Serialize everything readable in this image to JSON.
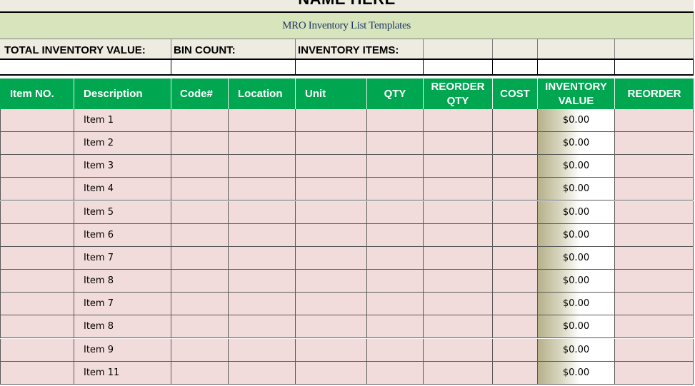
{
  "sheet": {
    "title": "NAME HERE",
    "subtitle": "MRO Inventory List Templates"
  },
  "summary": {
    "total_inventory_value_label": "TOTAL INVENTORY VALUE:",
    "bin_count_label": "BIN COUNT:",
    "inventory_items_label": "INVENTORY ITEMS:"
  },
  "table": {
    "headers": [
      "Item NO.",
      "Description",
      "Code#",
      "Location",
      "Unit",
      "QTY",
      "REORDER QTY",
      "COST",
      "INVENTORY VALUE",
      "REORDER"
    ],
    "rows": [
      {
        "item_no": "",
        "description": "Item 1",
        "code": "",
        "location": "",
        "unit": "",
        "qty": "",
        "reorder_qty": "",
        "cost": "",
        "inventory_value": "$0.00",
        "reorder": ""
      },
      {
        "item_no": "",
        "description": "Item 2",
        "code": "",
        "location": "",
        "unit": "",
        "qty": "",
        "reorder_qty": "",
        "cost": "",
        "inventory_value": "$0.00",
        "reorder": ""
      },
      {
        "item_no": "",
        "description": "Item 3",
        "code": "",
        "location": "",
        "unit": "",
        "qty": "",
        "reorder_qty": "",
        "cost": "",
        "inventory_value": "$0.00",
        "reorder": ""
      },
      {
        "item_no": "",
        "description": "Item 4",
        "code": "",
        "location": "",
        "unit": "",
        "qty": "",
        "reorder_qty": "",
        "cost": "",
        "inventory_value": "$0.00",
        "reorder": ""
      },
      {
        "item_no": "",
        "description": "Item 5",
        "code": "",
        "location": "",
        "unit": "",
        "qty": "",
        "reorder_qty": "",
        "cost": "",
        "inventory_value": "$0.00",
        "reorder": ""
      },
      {
        "item_no": "",
        "description": "Item 6",
        "code": "",
        "location": "",
        "unit": "",
        "qty": "",
        "reorder_qty": "",
        "cost": "",
        "inventory_value": "$0.00",
        "reorder": ""
      },
      {
        "item_no": "",
        "description": "Item 7",
        "code": "",
        "location": "",
        "unit": "",
        "qty": "",
        "reorder_qty": "",
        "cost": "",
        "inventory_value": "$0.00",
        "reorder": ""
      },
      {
        "item_no": "",
        "description": "Item 8",
        "code": "",
        "location": "",
        "unit": "",
        "qty": "",
        "reorder_qty": "",
        "cost": "",
        "inventory_value": "$0.00",
        "reorder": ""
      },
      {
        "item_no": "",
        "description": "Item 7",
        "code": "",
        "location": "",
        "unit": "",
        "qty": "",
        "reorder_qty": "",
        "cost": "",
        "inventory_value": "$0.00",
        "reorder": ""
      },
      {
        "item_no": "",
        "description": "Item 8",
        "code": "",
        "location": "",
        "unit": "",
        "qty": "",
        "reorder_qty": "",
        "cost": "",
        "inventory_value": "$0.00",
        "reorder": ""
      },
      {
        "item_no": "",
        "description": "Item 9",
        "code": "",
        "location": "",
        "unit": "",
        "qty": "",
        "reorder_qty": "",
        "cost": "",
        "inventory_value": "$0.00",
        "reorder": ""
      },
      {
        "item_no": "",
        "description": "Item 11",
        "code": "",
        "location": "",
        "unit": "",
        "qty": "",
        "reorder_qty": "",
        "cost": "",
        "inventory_value": "$0.00",
        "reorder": ""
      }
    ]
  },
  "colors": {
    "header_green": "#00a650",
    "row_pink": "#f2dcdb",
    "subtitle_band": "#d7e4bc",
    "title_band": "#eeece1",
    "subtitle_text": "#1f3864"
  }
}
